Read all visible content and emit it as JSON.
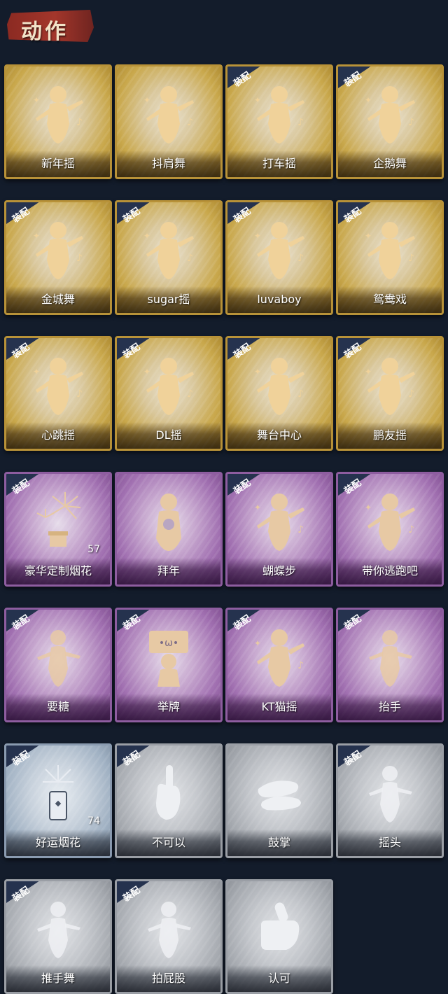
{
  "header": {
    "title": "动作"
  },
  "equip_label": "装配",
  "colors": {
    "gold": "#c9a84c",
    "purple": "#a170b1",
    "blue": "#9fb0c2",
    "gray": "#a3a7ad",
    "background": "#131c2b"
  },
  "cards": [
    {
      "label": "新年摇",
      "rarity": "gold",
      "equipped": false,
      "icon": "dancer-icon"
    },
    {
      "label": "抖肩舞",
      "rarity": "gold",
      "equipped": false,
      "icon": "dancer-icon"
    },
    {
      "label": "打车摇",
      "rarity": "gold",
      "equipped": true,
      "icon": "dancer-icon"
    },
    {
      "label": "企鹅舞",
      "rarity": "gold",
      "equipped": true,
      "icon": "dancer-icon"
    },
    {
      "label": "金城舞",
      "rarity": "gold",
      "equipped": true,
      "icon": "dancer-icon"
    },
    {
      "label": "sugar摇",
      "rarity": "gold",
      "equipped": true,
      "icon": "dancer-icon"
    },
    {
      "label": "luvaboy",
      "rarity": "gold",
      "equipped": true,
      "icon": "dancer-icon"
    },
    {
      "label": "鸳鸯戏",
      "rarity": "gold",
      "equipped": true,
      "icon": "dancer-icon"
    },
    {
      "label": "心跳摇",
      "rarity": "gold",
      "equipped": true,
      "icon": "dancer-icon"
    },
    {
      "label": "DL摇",
      "rarity": "gold",
      "equipped": true,
      "icon": "dancer-icon"
    },
    {
      "label": "舞台中心",
      "rarity": "gold",
      "equipped": true,
      "icon": "dancer-icon"
    },
    {
      "label": "鹏友摇",
      "rarity": "gold",
      "equipped": true,
      "icon": "dancer-icon"
    },
    {
      "label": "豪华定制烟花",
      "rarity": "purple",
      "equipped": true,
      "icon": "fireworks-icon",
      "count": "57"
    },
    {
      "label": "拜年",
      "rarity": "purple",
      "equipped": false,
      "icon": "bow-greeting-icon"
    },
    {
      "label": "蝴蝶步",
      "rarity": "purple",
      "equipped": true,
      "icon": "dancer-icon"
    },
    {
      "label": "带你逃跑吧",
      "rarity": "purple",
      "equipped": true,
      "icon": "dancer-icon"
    },
    {
      "label": "要糖",
      "rarity": "purple",
      "equipped": true,
      "icon": "figure-icon"
    },
    {
      "label": "举牌",
      "rarity": "purple",
      "equipped": true,
      "icon": "sign-icon"
    },
    {
      "label": "KT猫摇",
      "rarity": "purple",
      "equipped": true,
      "icon": "dancer-icon"
    },
    {
      "label": "抬手",
      "rarity": "purple",
      "equipped": true,
      "icon": "figure-icon"
    },
    {
      "label": "好运烟花",
      "rarity": "blue",
      "equipped": true,
      "icon": "firecracker-icon",
      "count": "74"
    },
    {
      "label": "不可以",
      "rarity": "gray",
      "equipped": true,
      "icon": "finger-icon"
    },
    {
      "label": "鼓掌",
      "rarity": "gray",
      "equipped": false,
      "icon": "clap-icon"
    },
    {
      "label": "摇头",
      "rarity": "gray",
      "equipped": true,
      "icon": "figure-icon"
    },
    {
      "label": "推手舞",
      "rarity": "gray",
      "equipped": true,
      "icon": "figure-icon"
    },
    {
      "label": "拍屁股",
      "rarity": "gray",
      "equipped": true,
      "icon": "figure-icon"
    },
    {
      "label": "认可",
      "rarity": "gray",
      "equipped": false,
      "icon": "thumbs-up-icon"
    }
  ]
}
